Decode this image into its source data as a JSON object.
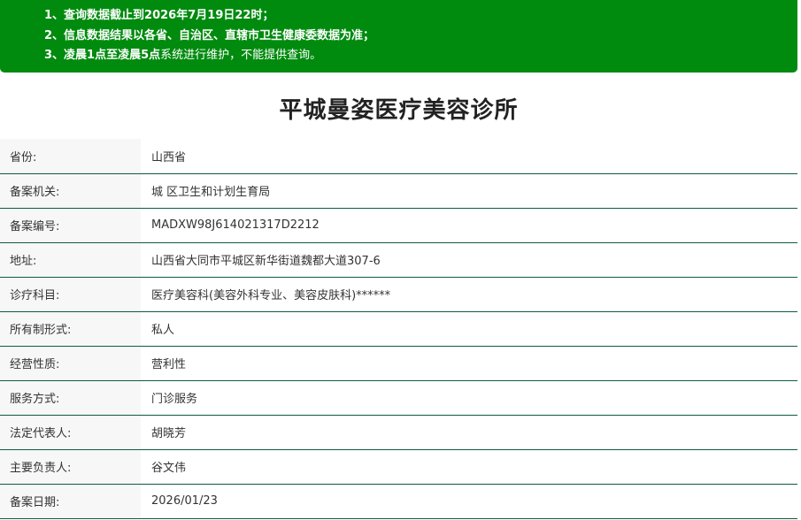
{
  "notice": {
    "line1": "1、查询数据截止到2026年7月19日22时；",
    "line2": "2、信息数据结果以各省、自治区、直辖市卫生健康委数据为准；",
    "line3_bold": "3、凌晨1点至凌晨5点",
    "line3_rest": "系统进行维护，不能提供查询。"
  },
  "title": "平城曼姿医疗美容诊所",
  "rows": [
    {
      "label": "省份:",
      "value": "山西省"
    },
    {
      "label": "备案机关:",
      "value": "城 区卫生和计划生育局"
    },
    {
      "label": "备案编号:",
      "value": "MADXW98J614021317D2212"
    },
    {
      "label": "地址:",
      "value": "山西省大同市平城区新华街道魏都大道307-6"
    },
    {
      "label": "诊疗科目:",
      "value": "医疗美容科(美容外科专业、美容皮肤科)******"
    },
    {
      "label": "所有制形式:",
      "value": "私人"
    },
    {
      "label": "经营性质:",
      "value": "营利性"
    },
    {
      "label": "服务方式:",
      "value": "门诊服务"
    },
    {
      "label": "法定代表人:",
      "value": "胡晓芳"
    },
    {
      "label": "主要负责人:",
      "value": "谷文伟"
    },
    {
      "label": "备案日期:",
      "value": "2026/01/23"
    }
  ],
  "colors": {
    "notice_bg": "#008b0e",
    "row_border": "#0d5c40",
    "label_bg": "#f7f7f7"
  }
}
